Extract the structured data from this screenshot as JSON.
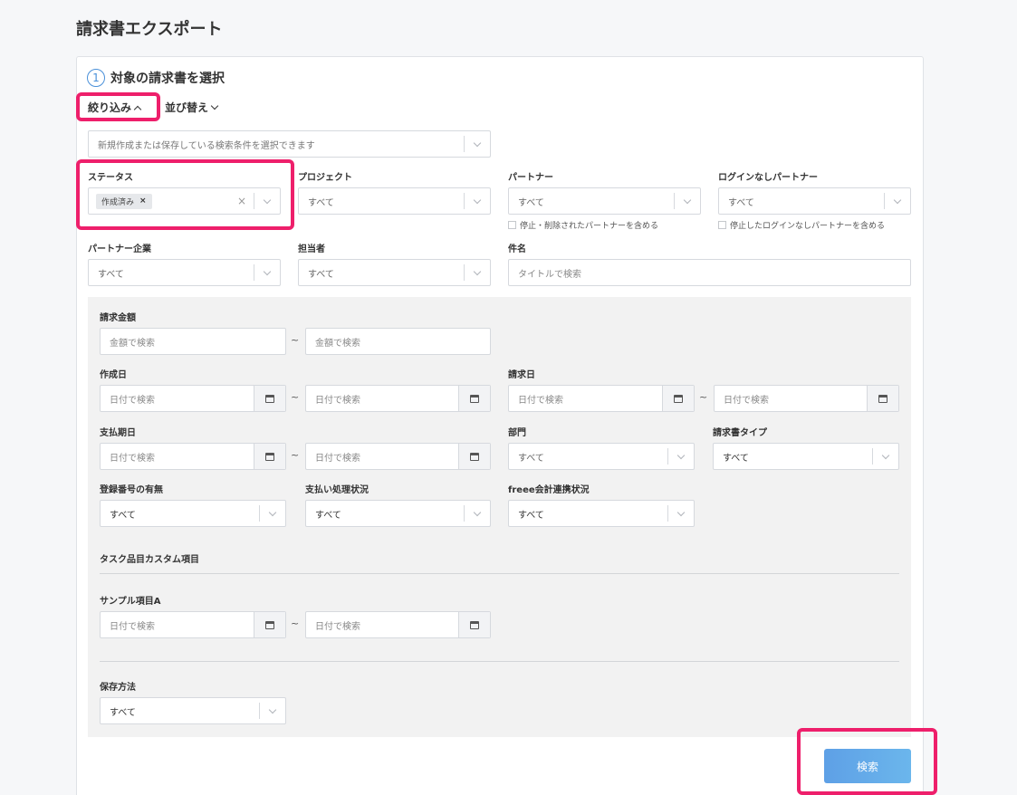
{
  "page_title": "請求書エクスポート",
  "step": {
    "number": "1",
    "title": "対象の請求書を選択"
  },
  "toggles": {
    "filter": "絞り込み",
    "sort": "並び替え"
  },
  "saved_search": {
    "placeholder": "新規作成または保存している検索条件を選択できます"
  },
  "filters": {
    "status": {
      "label": "ステータス",
      "chip": "作成済み",
      "chip_remove": "×",
      "clear": "×"
    },
    "project": {
      "label": "プロジェクト",
      "value": "すべて"
    },
    "partner": {
      "label": "パートナー",
      "value": "すべて",
      "checkbox": "停止・削除されたパートナーを含める"
    },
    "nologin_partner": {
      "label": "ログインなしパートナー",
      "value": "すべて",
      "checkbox": "停止したログインなしパートナーを含める"
    },
    "partner_company": {
      "label": "パートナー企業",
      "value": "すべて"
    },
    "assignee": {
      "label": "担当者",
      "value": "すべて"
    },
    "subject": {
      "label": "件名",
      "placeholder": "タイトルで検索"
    }
  },
  "advanced": {
    "amount": {
      "label": "請求金額",
      "from": "金額で検索",
      "to": "金額で検索"
    },
    "created": {
      "label": "作成日",
      "from": "日付で検索",
      "to": "日付で検索"
    },
    "billing_date": {
      "label": "請求日",
      "from": "日付で検索",
      "to": "日付で検索"
    },
    "due_date": {
      "label": "支払期日",
      "from": "日付で検索",
      "to": "日付で検索"
    },
    "department": {
      "label": "部門",
      "value": "すべて"
    },
    "invoice_type": {
      "label": "請求書タイプ",
      "value": "すべて"
    },
    "registration": {
      "label": "登録番号の有無",
      "value": "すべて"
    },
    "payment_status": {
      "label": "支払い処理状況",
      "value": "すべて"
    },
    "freee_status": {
      "label": "freee会計連携状況",
      "value": "すべて"
    },
    "custom_section": "タスク品目カスタム項目",
    "sample_a": {
      "label": "サンプル項目A",
      "from": "日付で検索",
      "to": "日付で検索"
    },
    "storage": {
      "label": "保存方法",
      "value": "すべて"
    },
    "tilde": "~"
  },
  "search_button": "検索",
  "colors": {
    "highlight": "#ee1f6b",
    "accent": "#4a90d9",
    "button": "#5ea0e6"
  }
}
